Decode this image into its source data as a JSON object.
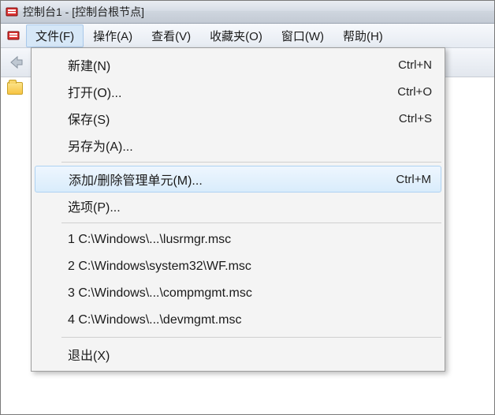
{
  "title": "控制台1 - [控制台根节点]",
  "menubar": {
    "file": "文件(F)",
    "action": "操作(A)",
    "view": "查看(V)",
    "favorites": "收藏夹(O)",
    "window": "窗口(W)",
    "help": "帮助(H)"
  },
  "file_menu": {
    "new": {
      "label": "新建(N)",
      "accel": "Ctrl+N"
    },
    "open": {
      "label": "打开(O)...",
      "accel": "Ctrl+O"
    },
    "save": {
      "label": "保存(S)",
      "accel": "Ctrl+S"
    },
    "saveas": {
      "label": "另存为(A)...",
      "accel": ""
    },
    "addremove": {
      "label": "添加/删除管理单元(M)...",
      "accel": "Ctrl+M"
    },
    "options": {
      "label": "选项(P)...",
      "accel": ""
    },
    "recent1": {
      "label": "1 C:\\Windows\\...\\lusrmgr.msc",
      "accel": ""
    },
    "recent2": {
      "label": "2 C:\\Windows\\system32\\WF.msc",
      "accel": ""
    },
    "recent3": {
      "label": "3 C:\\Windows\\...\\compmgmt.msc",
      "accel": ""
    },
    "recent4": {
      "label": "4 C:\\Windows\\...\\devmgmt.msc",
      "accel": ""
    },
    "exit": {
      "label": "退出(X)",
      "accel": ""
    }
  }
}
